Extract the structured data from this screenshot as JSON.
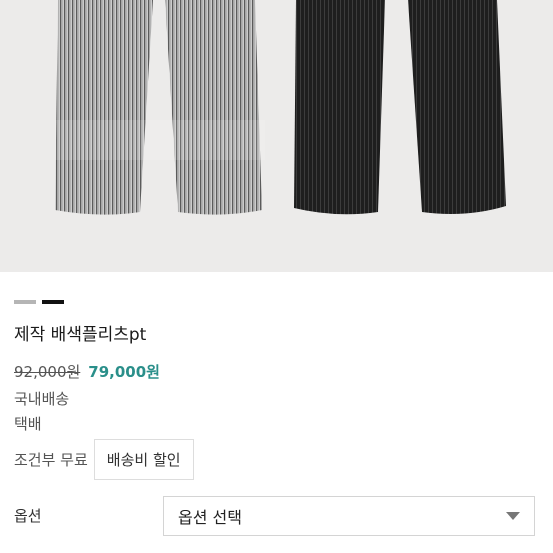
{
  "product": {
    "swatch_colors": [
      "#b5b5b5",
      "#111111"
    ],
    "title": "제작 배색플리츠pt",
    "original_price": "92,000원",
    "sale_price": "79,000원",
    "shipping_origin": "국내배송",
    "shipping_method": "택배",
    "shipping_fee_label": "조건부 무료",
    "shipping_discount_button": "배송비 할인"
  },
  "options": {
    "label": "옵션",
    "select_value": "옵션 선택"
  },
  "colors": {
    "sale_price": "#2a8f8a",
    "hero_background": "#ecebea"
  }
}
